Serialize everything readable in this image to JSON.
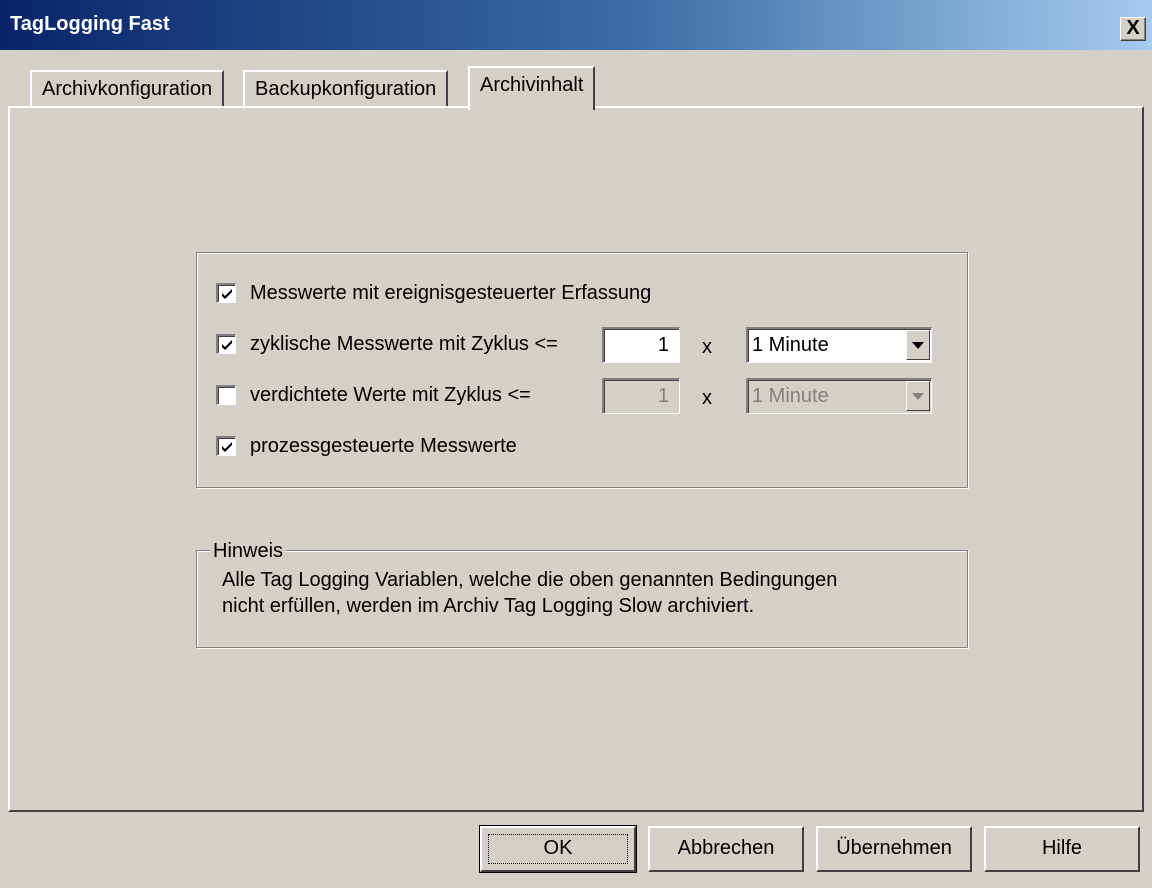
{
  "window": {
    "title": "TagLogging Fast",
    "close_label": "X"
  },
  "tabs": [
    {
      "label": "Archivkonfiguration"
    },
    {
      "label": "Backupkonfiguration"
    },
    {
      "label": "Archivinhalt"
    }
  ],
  "options": {
    "event_driven": {
      "label": "Messwerte mit ereignisgesteuerter Erfassung",
      "checked": true
    },
    "cyclic": {
      "label": "zyklische Messwerte mit Zyklus <=",
      "checked": true,
      "factor": "1",
      "times": "x",
      "unit": "1 Minute"
    },
    "compressed": {
      "label": "verdichtete Werte mit Zyklus <=",
      "checked": false,
      "factor": "1",
      "times": "x",
      "unit": "1 Minute"
    },
    "process_driven": {
      "label": "prozessgesteuerte Messwerte",
      "checked": true
    }
  },
  "hint": {
    "title": "Hinweis",
    "line1": "Alle Tag Logging Variablen, welche die oben genannten Bedingungen",
    "line2": "nicht erfüllen, werden im Archiv Tag Logging Slow archiviert."
  },
  "buttons": {
    "ok": "OK",
    "cancel": "Abbrechen",
    "apply": "Übernehmen",
    "help": "Hilfe"
  }
}
